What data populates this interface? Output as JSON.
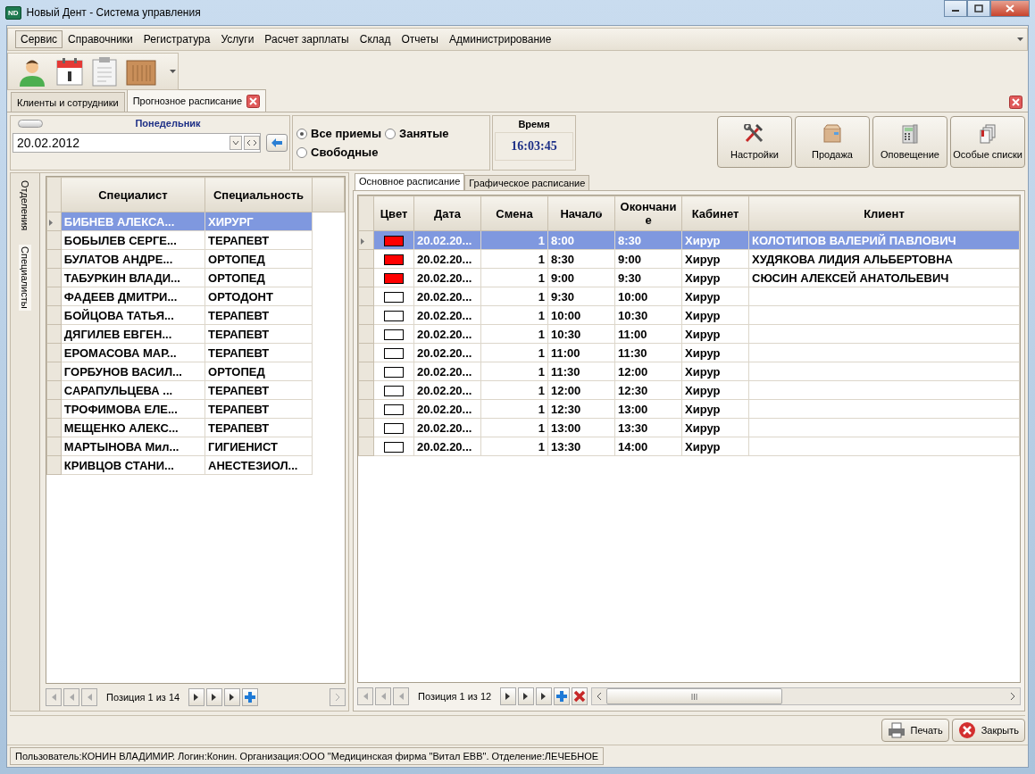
{
  "window": {
    "app_icon_text": "ND",
    "title": "Новый Дент - Система управления"
  },
  "menu": [
    {
      "label": "Сервис",
      "selected": true
    },
    {
      "label": "Справочники",
      "selected": false
    },
    {
      "label": "Регистратура",
      "selected": false
    },
    {
      "label": "Услуги",
      "selected": false
    },
    {
      "label": "Расчет зарплаты",
      "selected": false
    },
    {
      "label": "Склад",
      "selected": false
    },
    {
      "label": "Отчеты",
      "selected": false
    },
    {
      "label": "Администрирование",
      "selected": false
    }
  ],
  "doc_tabs": [
    {
      "label": "Клиенты и сотрудники",
      "selected": false,
      "closable": false
    },
    {
      "label": "Прогнозное расписание",
      "selected": true,
      "closable": true
    }
  ],
  "date_panel": {
    "day": "Понедельник",
    "date": "20.02.2012"
  },
  "filter": [
    {
      "label": "Все приемы",
      "selected": true
    },
    {
      "label": "Занятые",
      "selected": false
    },
    {
      "label": "Свободные",
      "selected": false
    }
  ],
  "time_panel": {
    "title": "Время",
    "value": "16:03:45"
  },
  "actions": [
    {
      "label": "Настройки",
      "kind": "tools"
    },
    {
      "label": "Продажа",
      "kind": "box"
    },
    {
      "label": "Оповещение",
      "kind": "phone"
    },
    {
      "label": "Особые списки",
      "kind": "docs"
    }
  ],
  "side_tabs": [
    {
      "label": "Отделения",
      "selected": false
    },
    {
      "label": "Специалисты",
      "selected": true
    }
  ],
  "specialists": {
    "columns": [
      "Специалист",
      "Специальность"
    ],
    "rows": [
      {
        "name": "БИБНЕВ АЛЕКСА...",
        "specialty": "ХИРУРГ",
        "selected": true
      },
      {
        "name": "БОБЫЛЕВ СЕРГЕ...",
        "specialty": "ТЕРАПЕВТ",
        "selected": false
      },
      {
        "name": "БУЛАТОВ АНДРЕ...",
        "specialty": "ОРТОПЕД",
        "selected": false
      },
      {
        "name": "ТАБУРКИН ВЛАДИ...",
        "specialty": "ОРТОПЕД",
        "selected": false
      },
      {
        "name": "ФАДЕЕВ ДМИТРИ...",
        "specialty": "ОРТОДОНТ",
        "selected": false
      },
      {
        "name": "БОЙЦОВА ТАТЬЯ...",
        "specialty": "ТЕРАПЕВТ",
        "selected": false
      },
      {
        "name": "ДЯГИЛЕВ ЕВГЕН...",
        "specialty": "ТЕРАПЕВТ",
        "selected": false
      },
      {
        "name": "ЕРОМАСОВА МАР...",
        "specialty": "ТЕРАПЕВТ",
        "selected": false
      },
      {
        "name": "ГОРБУНОВ ВАСИЛ...",
        "specialty": "ОРТОПЕД",
        "selected": false
      },
      {
        "name": "САРАПУЛЬЦЕВА ...",
        "specialty": "ТЕРАПЕВТ",
        "selected": false
      },
      {
        "name": "ТРОФИМОВА ЕЛЕ...",
        "specialty": "ТЕРАПЕВТ",
        "selected": false
      },
      {
        "name": "МЕЩЕНКО АЛЕКС...",
        "specialty": "ТЕРАПЕВТ",
        "selected": false
      },
      {
        "name": "МАРТЫНОВА Мил...",
        "specialty": "ГИГИЕНИСТ",
        "selected": false
      },
      {
        "name": "КРИВЦОВ СТАНИ...",
        "specialty": "АНЕСТЕЗИОЛ...",
        "selected": false
      }
    ],
    "position": "Позиция 1 из 14"
  },
  "schedule_tabs": [
    {
      "label": "Основное расписание",
      "selected": true
    },
    {
      "label": "Графическое расписание",
      "selected": false
    }
  ],
  "schedule": {
    "columns": [
      "Цвет",
      "Дата",
      "Смена",
      "Начало",
      "Окончание",
      "Кабинет",
      "Клиент"
    ],
    "rows": [
      {
        "color": "#ff0000",
        "date": "20.02.20...",
        "shift": "1",
        "start": "8:00",
        "end": "8:30",
        "cabinet": "Хирур",
        "client": "КОЛОТИПОВ ВАЛЕРИЙ ПАВЛОВИЧ",
        "selected": true
      },
      {
        "color": "#ff0000",
        "date": "20.02.20...",
        "shift": "1",
        "start": "8:30",
        "end": "9:00",
        "cabinet": "Хирур",
        "client": "ХУДЯКОВА ЛИДИЯ АЛЬБЕРТОВНА",
        "selected": false
      },
      {
        "color": "#ff0000",
        "date": "20.02.20...",
        "shift": "1",
        "start": "9:00",
        "end": "9:30",
        "cabinet": "Хирур",
        "client": "СЮСИН АЛЕКСЕЙ АНАТОЛЬЕВИЧ",
        "selected": false
      },
      {
        "color": "#ffffff",
        "date": "20.02.20...",
        "shift": "1",
        "start": "9:30",
        "end": "10:00",
        "cabinet": "Хирур",
        "selected": false
      },
      {
        "color": "#ffffff",
        "date": "20.02.20...",
        "shift": "1",
        "start": "10:00",
        "end": "10:30",
        "cabinet": "Хирур",
        "selected": false
      },
      {
        "color": "#ffffff",
        "date": "20.02.20...",
        "shift": "1",
        "start": "10:30",
        "end": "11:00",
        "cabinet": "Хирур",
        "selected": false
      },
      {
        "color": "#ffffff",
        "date": "20.02.20...",
        "shift": "1",
        "start": "11:00",
        "end": "11:30",
        "cabinet": "Хирур",
        "selected": false
      },
      {
        "color": "#ffffff",
        "date": "20.02.20...",
        "shift": "1",
        "start": "11:30",
        "end": "12:00",
        "cabinet": "Хирур",
        "selected": false
      },
      {
        "color": "#ffffff",
        "date": "20.02.20...",
        "shift": "1",
        "start": "12:00",
        "end": "12:30",
        "cabinet": "Хирур",
        "selected": false
      },
      {
        "color": "#ffffff",
        "date": "20.02.20...",
        "shift": "1",
        "start": "12:30",
        "end": "13:00",
        "cabinet": "Хирур",
        "selected": false
      },
      {
        "color": "#ffffff",
        "date": "20.02.20...",
        "shift": "1",
        "start": "13:00",
        "end": "13:30",
        "cabinet": "Хирур",
        "selected": false
      },
      {
        "color": "#ffffff",
        "date": "20.02.20...",
        "shift": "1",
        "start": "13:30",
        "end": "14:00",
        "cabinet": "Хирур",
        "selected": false
      }
    ],
    "position": "Позиция 1 из 12"
  },
  "buttons": [
    {
      "label": "Печать",
      "kind": "print"
    },
    {
      "label": "Закрыть",
      "kind": "close"
    }
  ],
  "status_bar": "Пользователь:КОНИН ВЛАДИМИР. Логин:Конин. Организация:ООО \"Медицинская фирма \"Витал ЕВВ\". Отделение:ЛЕЧЕБНОЕ"
}
